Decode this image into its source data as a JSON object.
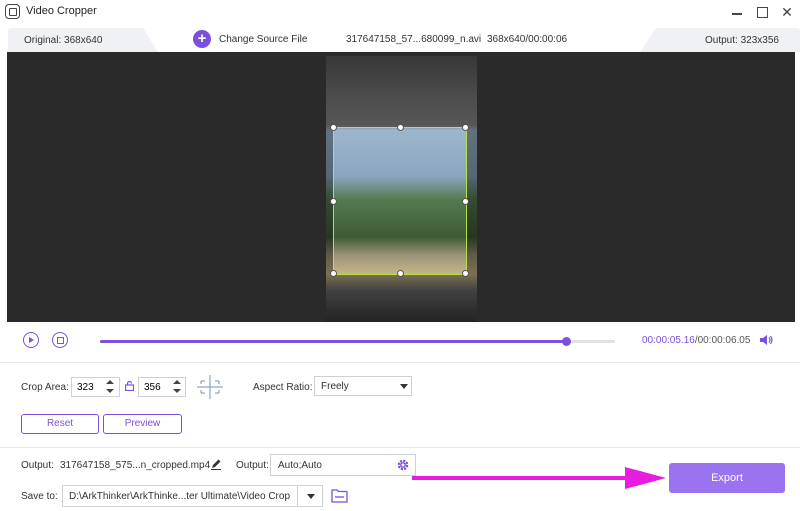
{
  "window": {
    "title": "Video Cropper"
  },
  "infobar": {
    "original": "Original: 368x640",
    "change_source": "Change Source File",
    "file_name": "317647158_57...680099_n.avi",
    "file_info": "368x640/00:00:06",
    "output": "Output: 323x356"
  },
  "player": {
    "time_current": "00:00:05.16",
    "time_total": "/00:00:06.05",
    "progress_fraction": 0.904
  },
  "crop": {
    "area_label": "Crop Area:",
    "width": "323",
    "height": "356",
    "aspect_label": "Aspect Ratio:",
    "aspect_value": "Freely"
  },
  "buttons": {
    "reset": "Reset",
    "preview": "Preview",
    "export": "Export"
  },
  "output": {
    "label": "Output:",
    "filename": "317647158_575...n_cropped.mp4",
    "format_label": "Output:",
    "format_value": "Auto;Auto",
    "save_label": "Save to:",
    "save_path": "D:\\ArkThinker\\ArkThinke...ter Ultimate\\Video Crop"
  },
  "colors": {
    "accent": "#7b4fe0",
    "export_bg": "#9b72ef",
    "annotation_arrow": "#e81ce0",
    "crop_border": "#b8e04a"
  },
  "icons": [
    "app-icon",
    "minimize-icon",
    "maximize-icon",
    "close-icon",
    "plus-icon",
    "play-icon",
    "stop-icon",
    "volume-icon",
    "lock-icon",
    "center-icon",
    "chevron-down-icon",
    "pencil-icon",
    "gear-icon",
    "folder-icon",
    "arrow-annotation"
  ]
}
